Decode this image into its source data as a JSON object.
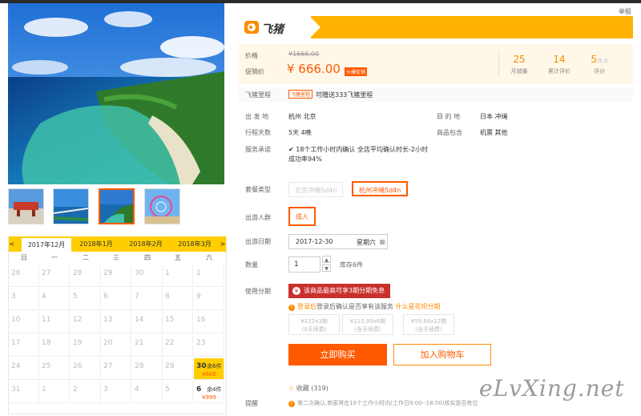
{
  "report": "举报",
  "brand": {
    "name": "飞猪",
    "color": "#ffb200"
  },
  "price": {
    "label_price": "价格",
    "original": "¥1666.00",
    "label_promo": "促销价",
    "promo": "¥ 666.00",
    "badge": "火爆促销"
  },
  "stats": [
    {
      "value": "25",
      "label": "月销量"
    },
    {
      "value": "14",
      "label": "累计评价"
    },
    {
      "value": "5",
      "unit": "/5.0",
      "label": "评分"
    }
  ],
  "mileage": {
    "label": "飞猪里程",
    "tag": "飞猪里程",
    "text": "可赠送333飞猪里程"
  },
  "info": {
    "depart_label": "出 发 地",
    "depart": "杭州  北京",
    "dest_label": "目 的 地",
    "dest": "日本  冲绳",
    "days_label": "行程天数",
    "days": "5天  4晚",
    "include_label": "商品包含",
    "include": "机票  其他",
    "service_label": "服务承诺",
    "service_line1": "18个工作小时内确认 全店平均确认时长-2小时",
    "service_line2": "成功率94%"
  },
  "package": {
    "label": "套餐类型",
    "options": [
      "北京冲绳5d4n",
      "杭州冲绳5d4n"
    ]
  },
  "crowd": {
    "label": "出游人群",
    "option": "成人"
  },
  "date": {
    "label": "出游日期",
    "value": "2017-12-30",
    "weekday": "星期六"
  },
  "quantity": {
    "label": "数量",
    "value": "1",
    "stock": "库存6件"
  },
  "installment": {
    "label": "使用分期",
    "banner": "该商品最高可享3期分期免息",
    "note_a": "登录后确认是否享有该服务",
    "note_link": "什么是花呗分期",
    "plans": [
      {
        "line1": "¥222x3期",
        "line2": "(0手续费)"
      },
      {
        "line1": "¥115.99x6期",
        "line2": "(含手续费)"
      },
      {
        "line1": "¥59.66x12期",
        "line2": "(含手续费)"
      }
    ]
  },
  "buttons": {
    "buy": "立即购买",
    "cart": "加入购物车"
  },
  "favorite": {
    "label": "收藏",
    "count": "(319)"
  },
  "remind": {
    "label": "提醒",
    "text": "需二次确认,商家将在18个工作小时内(工作日9:00--18:00)核实是否有位"
  },
  "calendar": {
    "tabs": [
      "2017年12月",
      "2018年1月",
      "2018年2月",
      "2018年3月"
    ],
    "prev": "<",
    "next": ">",
    "weekdays": [
      "日",
      "一",
      "二",
      "三",
      "四",
      "五",
      "六"
    ],
    "weeks": [
      [
        "26",
        "27",
        "28",
        "29",
        "30",
        "1",
        "2"
      ],
      [
        "3",
        "4",
        "5",
        "6",
        "7",
        "8",
        "9"
      ],
      [
        "10",
        "11",
        "12",
        "13",
        "14",
        "15",
        "16"
      ],
      [
        "17",
        "18",
        "19",
        "20",
        "21",
        "22",
        "23"
      ],
      [
        "24",
        "25",
        "26",
        "27",
        "28",
        "29",
        "30"
      ],
      [
        "31",
        "1",
        "2",
        "3",
        "4",
        "5",
        "6"
      ]
    ],
    "highlight": {
      "day": "30",
      "rest": "余6件",
      "price": "¥666"
    },
    "avail": {
      "day": "6",
      "rest": "余4件",
      "price": "¥999"
    }
  },
  "watermark": "eLvXing.net",
  "accent": "#ff5a00"
}
